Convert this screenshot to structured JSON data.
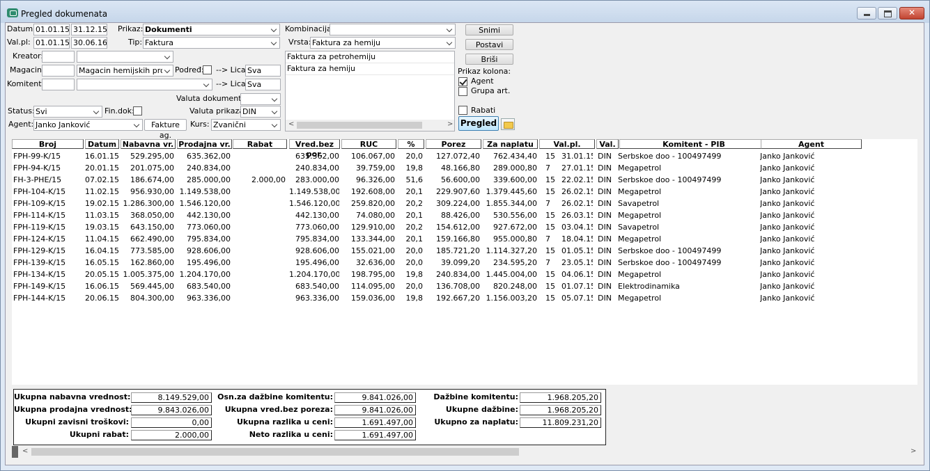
{
  "window": {
    "title": "Pregled dokumenata",
    "close_label": "✕"
  },
  "filters": {
    "datum_label": "Datum:",
    "datum_from": "01.01.15",
    "datum_to": "31.12.15",
    "valpl_label": "Val.pl:",
    "valpl_from": "01.01.15",
    "valpl_to": "30.06.16",
    "prikaz_label": "Prikaz:",
    "prikaz_value": "Dokumenti",
    "tip_label": "Tip:",
    "tip_value": "Faktura",
    "kreator_label": "Kreator:",
    "kreator_code": "",
    "kreator_value": "",
    "magacin_label": "Magacin:",
    "magacin_code": "",
    "magacin_value": "Magacin hemijskih proizv",
    "podred_label": "Podređ:",
    "lica_label": "--> Lica:",
    "lica_value_1": "Sva",
    "komitent_label": "Komitent:",
    "komitent_code": "",
    "komitent_value": "",
    "lica_value_2": "Sva",
    "valuta_dok_label": "Valuta dokumenta:",
    "valuta_dok_value": "",
    "status_label": "Status:",
    "status_value": "Svi",
    "findok_label": "Fin.dok:",
    "valuta_prikaza_label": "Valuta prikaza:",
    "valuta_prikaza_value": "DIN",
    "agent_label": "Agent:",
    "agent_value": "Janko Janković",
    "fakture_ag_label": "Fakture ag.",
    "kurs_label": "Kurs:",
    "kurs_value": "Zvanični",
    "kombinacija_label": "Kombinacija:",
    "kombinacija_value": "",
    "vrsta_label": "Vrsta:",
    "vrsta_value": "Faktura za hemiju",
    "list_items": [
      "Faktura za petrohemiju",
      "Faktura za hemiju"
    ]
  },
  "actions": {
    "snimi": "Snimi",
    "postavi": "Postavi",
    "brisi": "Briši",
    "prikaz_kolona": "Prikaz kolona:",
    "agent": "Agent",
    "grupa_art": "Grupa art.",
    "rabati": "Rabati",
    "pregled": "Pregled"
  },
  "table": {
    "headers": [
      "Broj",
      "Datum",
      "Nabavna vr.",
      "Prodajna vr.",
      "Rabat",
      "Vred.bez por.",
      "RUC",
      "%",
      "Porez",
      "Za naplatu",
      "Val.pl.",
      "Val.",
      "Komitent - PIB",
      "Agent"
    ],
    "rows": [
      [
        "FPH-99-K/15",
        "16.01.15",
        "529.295,00",
        "635.362,00",
        "",
        "635.362,00",
        "106.067,00",
        "20,0",
        "127.072,40",
        "762.434,40",
        "15",
        "31.01.15",
        "DIN",
        "Serbskoe doo - 100497499",
        "Janko Janković"
      ],
      [
        "FPH-94-K/15",
        "20.01.15",
        "201.075,00",
        "240.834,00",
        "",
        "240.834,00",
        "39.759,00",
        "19,8",
        "48.166,80",
        "289.000,80",
        "7",
        "27.01.15",
        "DIN",
        "Megapetrol",
        "Janko Janković"
      ],
      [
        "FH-3-PHE/15",
        "07.02.15",
        "186.674,00",
        "285.000,00",
        "2.000,00",
        "283.000,00",
        "96.326,00",
        "51,6",
        "56.600,00",
        "339.600,00",
        "15",
        "22.02.15",
        "DIN",
        "Serbskoe doo - 100497499",
        "Janko Janković"
      ],
      [
        "FPH-104-K/15",
        "11.02.15",
        "956.930,00",
        "1.149.538,00",
        "",
        "1.149.538,00",
        "192.608,00",
        "20,1",
        "229.907,60",
        "1.379.445,60",
        "15",
        "26.02.15",
        "DIN",
        "Megapetrol",
        "Janko Janković"
      ],
      [
        "FPH-109-K/15",
        "19.02.15",
        "1.286.300,00",
        "1.546.120,00",
        "",
        "1.546.120,00",
        "259.820,00",
        "20,2",
        "309.224,00",
        "1.855.344,00",
        "7",
        "26.02.15",
        "DIN",
        "Savapetrol",
        "Janko Janković"
      ],
      [
        "FPH-114-K/15",
        "11.03.15",
        "368.050,00",
        "442.130,00",
        "",
        "442.130,00",
        "74.080,00",
        "20,1",
        "88.426,00",
        "530.556,00",
        "15",
        "26.03.15",
        "DIN",
        "Megapetrol",
        "Janko Janković"
      ],
      [
        "FPH-119-K/15",
        "19.03.15",
        "643.150,00",
        "773.060,00",
        "",
        "773.060,00",
        "129.910,00",
        "20,2",
        "154.612,00",
        "927.672,00",
        "15",
        "03.04.15",
        "DIN",
        "Savapetrol",
        "Janko Janković"
      ],
      [
        "FPH-124-K/15",
        "11.04.15",
        "662.490,00",
        "795.834,00",
        "",
        "795.834,00",
        "133.344,00",
        "20,1",
        "159.166,80",
        "955.000,80",
        "7",
        "18.04.15",
        "DIN",
        "Megapetrol",
        "Janko Janković"
      ],
      [
        "FPH-129-K/15",
        "16.04.15",
        "773.585,00",
        "928.606,00",
        "",
        "928.606,00",
        "155.021,00",
        "20,0",
        "185.721,20",
        "1.114.327,20",
        "15",
        "01.05.15",
        "DIN",
        "Serbskoe doo - 100497499",
        "Janko Janković"
      ],
      [
        "FPH-139-K/15",
        "16.05.15",
        "162.860,00",
        "195.496,00",
        "",
        "195.496,00",
        "32.636,00",
        "20,0",
        "39.099,20",
        "234.595,20",
        "7",
        "23.05.15",
        "DIN",
        "Serbskoe doo - 100497499",
        "Janko Janković"
      ],
      [
        "FPH-134-K/15",
        "20.05.15",
        "1.005.375,00",
        "1.204.170,00",
        "",
        "1.204.170,00",
        "198.795,00",
        "19,8",
        "240.834,00",
        "1.445.004,00",
        "15",
        "04.06.15",
        "DIN",
        "Megapetrol",
        "Janko Janković"
      ],
      [
        "FPH-149-K/15",
        "16.06.15",
        "569.445,00",
        "683.540,00",
        "",
        "683.540,00",
        "114.095,00",
        "20,0",
        "136.708,00",
        "820.248,00",
        "15",
        "01.07.15",
        "DIN",
        "Elektrodinamika",
        "Janko Janković"
      ],
      [
        "FPH-144-K/15",
        "20.06.15",
        "804.300,00",
        "963.336,00",
        "",
        "963.336,00",
        "159.036,00",
        "19,8",
        "192.667,20",
        "1.156.003,20",
        "15",
        "05.07.15",
        "DIN",
        "Megapetrol",
        "Janko Janković"
      ]
    ]
  },
  "totals": {
    "nabavna_label": "Ukupna nabavna vrednost:",
    "nabavna": "8.149.529,00",
    "prodajna_label": "Ukupna prodajna vrednost:",
    "prodajna": "9.843.026,00",
    "zavisni_label": "Ukupni zavisni troškovi:",
    "zavisni": "0,00",
    "rabat_label": "Ukupni rabat:",
    "rabat": "2.000,00",
    "osn_label": "Osn.za dažbine komitentu:",
    "osn": "9.841.026,00",
    "vred_label": "Ukupna vred.bez poreza:",
    "vred": "9.841.026,00",
    "razlika_label": "Ukupna razlika u ceni:",
    "razlika": "1.691.497,00",
    "neto_label": "Neto razlika u ceni:",
    "neto": "1.691.497,00",
    "dazbine_kom_label": "Dažbine komitentu:",
    "dazbine_kom": "1.968.205,20",
    "dazbine_label": "Ukupne dažbine:",
    "dazbine": "1.968.205,20",
    "naplata_label": "Ukupno za naplatu:",
    "naplata": "11.809.231,20"
  }
}
